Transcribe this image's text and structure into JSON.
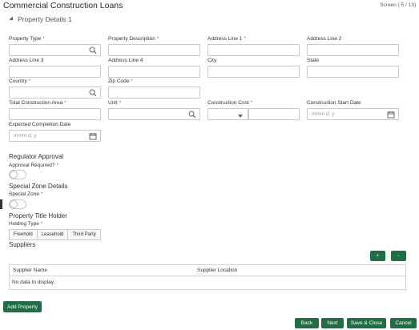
{
  "app": {
    "title": "Commercial Construction Loans",
    "screen_info": "Screen ( 5 / 13)"
  },
  "section": {
    "title": "Property Details 1"
  },
  "fields": {
    "property_type": {
      "label": "Property Type",
      "required": "*"
    },
    "property_description": {
      "label": "Property Description",
      "required": "*"
    },
    "address_line_1": {
      "label": "Address Line 1",
      "required": "*"
    },
    "address_line_2": {
      "label": "Address Line 2"
    },
    "address_line_3": {
      "label": "Address Line 3"
    },
    "address_line_4": {
      "label": "Address Line 4"
    },
    "city": {
      "label": "City"
    },
    "state": {
      "label": "State"
    },
    "country": {
      "label": "Country",
      "required": "*"
    },
    "zip_code": {
      "label": "Zip Code",
      "required": "*"
    },
    "total_construction_area": {
      "label": "Total Construction Area",
      "required": "*"
    },
    "unit": {
      "label": "Unit",
      "required": "*"
    },
    "construction_cost": {
      "label": "Construction Cost",
      "required": "*"
    },
    "construction_start_date": {
      "label": "Construction Start Date",
      "placeholder": "mmm d, y"
    },
    "expected_completion_date": {
      "label": "Expected Completion Date",
      "placeholder": "mmm d, y"
    }
  },
  "regulator": {
    "heading": "Regulator Approval",
    "label": "Approval Required?",
    "required": "*"
  },
  "special_zone": {
    "heading": "Special Zone Details",
    "label": "Special Zone",
    "required": "*"
  },
  "title_holder": {
    "heading": "Property Title Holder",
    "label": "Holding Type",
    "required": "*",
    "options": [
      "Freehold",
      "Leasehold",
      "Third Party"
    ]
  },
  "suppliers": {
    "heading": "Suppliers",
    "add_label": "+",
    "remove_label": "-",
    "columns": [
      "Supplier Name",
      "Supplier Location"
    ],
    "empty_text": "No data to display."
  },
  "actions": {
    "add_property": "Add Property",
    "back": "Back",
    "next": "Next",
    "save_close": "Save & Close",
    "cancel": "Cancel"
  },
  "colors": {
    "accent": "#1f6e44",
    "required": "#1a9ea3"
  }
}
